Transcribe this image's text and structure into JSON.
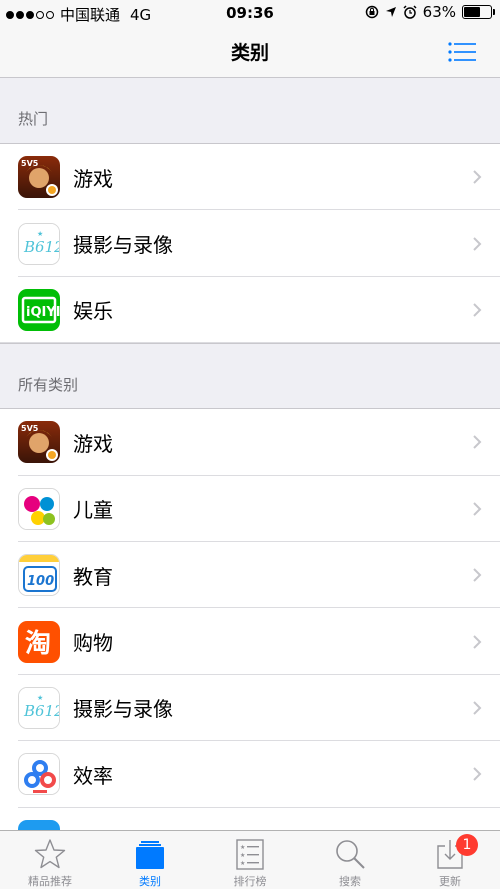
{
  "status_bar": {
    "carrier": "中国联通",
    "network": "4G",
    "time": "09:36",
    "battery": "63%",
    "battery_level": 0.63
  },
  "nav": {
    "title": "类别"
  },
  "sections": {
    "hot": {
      "header": "热门",
      "items": [
        {
          "label": "游戏",
          "icon": "game-icon"
        },
        {
          "label": "摄影与录像",
          "icon": "b612-icon"
        },
        {
          "label": "娱乐",
          "icon": "iqiyi-icon"
        }
      ]
    },
    "all": {
      "header": "所有类别",
      "items": [
        {
          "label": "游戏",
          "icon": "game-icon"
        },
        {
          "label": "儿童",
          "icon": "kids-icon"
        },
        {
          "label": "教育",
          "icon": "100-icon"
        },
        {
          "label": "购物",
          "icon": "taobao-icon"
        },
        {
          "label": "摄影与录像",
          "icon": "b612-icon"
        },
        {
          "label": "效率",
          "icon": "baidu-cloud-icon"
        }
      ]
    }
  },
  "tabs": [
    {
      "label": "精品推荐",
      "icon": "star-icon"
    },
    {
      "label": "类别",
      "icon": "categories-icon",
      "active": true
    },
    {
      "label": "排行榜",
      "icon": "ranking-icon"
    },
    {
      "label": "搜索",
      "icon": "search-icon"
    },
    {
      "label": "更新",
      "icon": "update-icon",
      "badge": "1"
    }
  ],
  "colors": {
    "accent": "#007aff",
    "badge": "#ff3b30",
    "iqiyi": "#00be06",
    "taobao": "#ff5000"
  }
}
